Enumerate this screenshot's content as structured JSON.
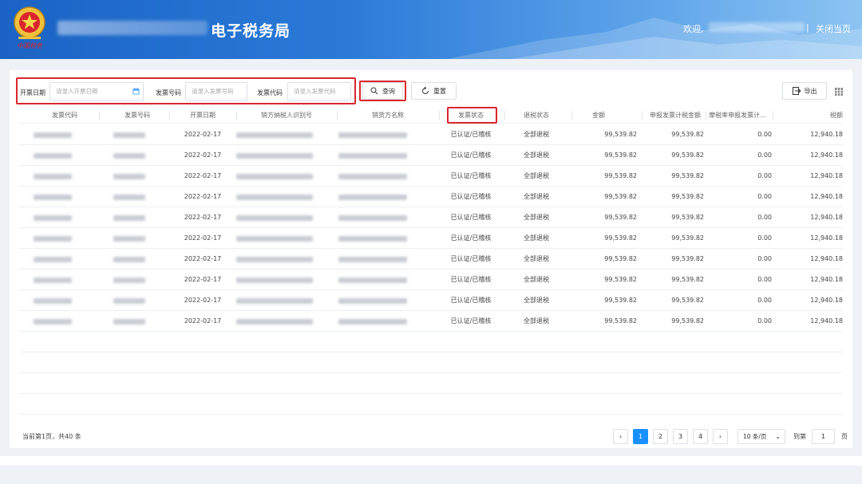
{
  "header": {
    "site_title": "电子税务局",
    "welcome": "欢迎,",
    "separator": "|",
    "close_page": "关闭当页",
    "emblem_text": "中国税务"
  },
  "filters": {
    "date_label": "开票日期",
    "date_placeholder": "请录入开票日期",
    "number_label": "发票号码",
    "number_placeholder": "请录入发票号码",
    "code_label": "发票代码",
    "code_placeholder": "请录入发票代码",
    "query_label": "查询",
    "reset_label": "重置",
    "export_label": "导出"
  },
  "table": {
    "columns": [
      "发票代码",
      "发票号码",
      "开票日期",
      "销方纳税人识别号",
      "销货方名称",
      "发票状态",
      "退税状态",
      "金额",
      "申报发票计税金额",
      "摩税率申报发票计...",
      "税额"
    ],
    "rows": [
      {
        "date": "2022-02-17",
        "status": "已认证/已稽核",
        "refund": "全部退税",
        "amount": "99,539.82",
        "taxable": "99,539.82",
        "rate": "0.00",
        "tax": "12,940.18"
      },
      {
        "date": "2022-02-17",
        "status": "已认证/已稽核",
        "refund": "全部退税",
        "amount": "99,539.82",
        "taxable": "99,539.82",
        "rate": "0.00",
        "tax": "12,940.18"
      },
      {
        "date": "2022-02-17",
        "status": "已认证/已稽核",
        "refund": "全部退税",
        "amount": "99,539.82",
        "taxable": "99,539.82",
        "rate": "0.00",
        "tax": "12,940.18"
      },
      {
        "date": "2022-02-17",
        "status": "已认证/已稽核",
        "refund": "全部退税",
        "amount": "99,539.82",
        "taxable": "99,539.82",
        "rate": "0.00",
        "tax": "12,940.18"
      },
      {
        "date": "2022-02-17",
        "status": "已认证/已稽核",
        "refund": "全部退税",
        "amount": "99,539.82",
        "taxable": "99,539.82",
        "rate": "0.00",
        "tax": "12,940.18"
      },
      {
        "date": "2022-02-17",
        "status": "已认证/已稽核",
        "refund": "全部退税",
        "amount": "99,539.82",
        "taxable": "99,539.82",
        "rate": "0.00",
        "tax": "12,940.18"
      },
      {
        "date": "2022-02-17",
        "status": "已认证/已稽核",
        "refund": "全部退税",
        "amount": "99,539.82",
        "taxable": "99,539.82",
        "rate": "0.00",
        "tax": "12,940.18"
      },
      {
        "date": "2022-02-17",
        "status": "已认证/已稽核",
        "refund": "全部退税",
        "amount": "99,539.82",
        "taxable": "99,539.82",
        "rate": "0.00",
        "tax": "12,940.18"
      },
      {
        "date": "2022-02-17",
        "status": "已认证/已稽核",
        "refund": "全部退税",
        "amount": "99,539.82",
        "taxable": "99,539.82",
        "rate": "0.00",
        "tax": "12,940.18"
      },
      {
        "date": "2022-02-17",
        "status": "已认证/已稽核",
        "refund": "全部退税",
        "amount": "99,539.82",
        "taxable": "99,539.82",
        "rate": "0.00",
        "tax": "12,940.18"
      }
    ]
  },
  "pagination": {
    "summary": "当前第1页，共40 条",
    "prev": "‹",
    "pages": [
      "1",
      "2",
      "3",
      "4"
    ],
    "next": "›",
    "page_size": "10 条/页",
    "goto_label": "到第",
    "goto_value": "1",
    "goto_suffix": "页"
  },
  "colors": {
    "accent": "#1890ff",
    "highlight_border": "#d9262c",
    "header_blue": "#1a63c4"
  },
  "icons": [
    "emblem-icon",
    "calendar-icon",
    "search-icon",
    "refresh-icon",
    "export-icon",
    "grid-icon",
    "chevron-down-icon"
  ]
}
